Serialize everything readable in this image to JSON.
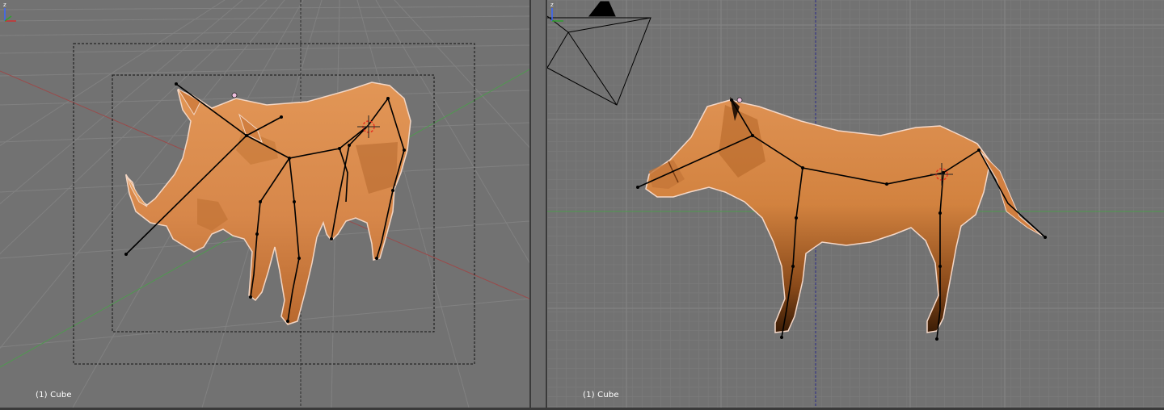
{
  "viewports": [
    {
      "id": "perspective",
      "label": "(1) Cube",
      "gizmo": {
        "z_label": "z"
      }
    },
    {
      "id": "side",
      "label": "(1) Cube",
      "gizmo": {
        "z_label": "z"
      }
    }
  ],
  "colors": {
    "viewport_bg": "#727272",
    "grid_line": "#7c7c7c",
    "mesh_orange": "#d7874a",
    "mesh_dark": "#6a3a12",
    "selection_outline": "#f5d8c8",
    "armature": "#000000",
    "x_axis_red": "#9a4a4a",
    "y_axis_green": "#4f9a4f",
    "cursor_red": "#e83020"
  }
}
